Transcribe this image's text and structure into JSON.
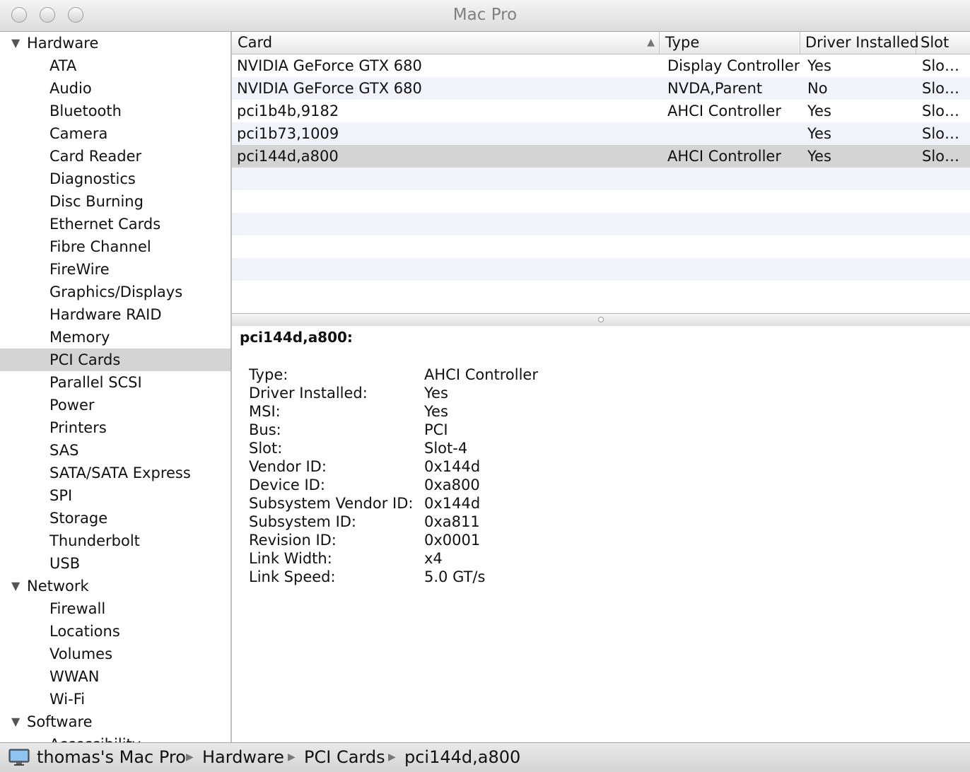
{
  "window": {
    "title": "Mac Pro"
  },
  "sidebar": {
    "hardware": {
      "label": "Hardware",
      "items": [
        "ATA",
        "Audio",
        "Bluetooth",
        "Camera",
        "Card Reader",
        "Diagnostics",
        "Disc Burning",
        "Ethernet Cards",
        "Fibre Channel",
        "FireWire",
        "Graphics/Displays",
        "Hardware RAID",
        "Memory",
        "PCI Cards",
        "Parallel SCSI",
        "Power",
        "Printers",
        "SAS",
        "SATA/SATA Express",
        "SPI",
        "Storage",
        "Thunderbolt",
        "USB"
      ]
    },
    "network": {
      "label": "Network",
      "items": [
        "Firewall",
        "Locations",
        "Volumes",
        "WWAN",
        "Wi-Fi"
      ]
    },
    "software": {
      "label": "Software",
      "items": [
        "Accessibility"
      ]
    },
    "selected": "PCI Cards"
  },
  "table": {
    "columns": {
      "card": "Card",
      "type": "Type",
      "driver": "Driver Installed",
      "slot": "Slot"
    },
    "rows": [
      {
        "card": "NVIDIA GeForce GTX 680",
        "type": "Display Controller",
        "driver": "Yes",
        "slot": "Slo…"
      },
      {
        "card": "NVIDIA GeForce GTX 680",
        "type": "NVDA,Parent",
        "driver": "No",
        "slot": "Slo…"
      },
      {
        "card": "pci1b4b,9182",
        "type": "AHCI Controller",
        "driver": "Yes",
        "slot": "Slo…"
      },
      {
        "card": "pci1b73,1009",
        "type": "",
        "driver": "Yes",
        "slot": "Slo…"
      },
      {
        "card": "pci144d,a800",
        "type": "AHCI Controller",
        "driver": "Yes",
        "slot": "Slo…"
      }
    ],
    "selected_row": 4
  },
  "detail": {
    "title": "pci144d,a800:",
    "fields": [
      {
        "key": "Type:",
        "value": "AHCI Controller"
      },
      {
        "key": "Driver Installed:",
        "value": "Yes"
      },
      {
        "key": "MSI:",
        "value": "Yes"
      },
      {
        "key": "Bus:",
        "value": "PCI"
      },
      {
        "key": "Slot:",
        "value": "Slot-4"
      },
      {
        "key": "Vendor ID:",
        "value": "0x144d"
      },
      {
        "key": "Device ID:",
        "value": "0xa800"
      },
      {
        "key": "Subsystem Vendor ID:",
        "value": "0x144d"
      },
      {
        "key": "Subsystem ID:",
        "value": "0xa811"
      },
      {
        "key": "Revision ID:",
        "value": "0x0001"
      },
      {
        "key": "Link Width:",
        "value": "x4"
      },
      {
        "key": "Link Speed:",
        "value": "5.0 GT/s"
      }
    ]
  },
  "pathbar": {
    "crumbs": [
      "thomas's Mac Pro",
      "Hardware",
      "PCI Cards",
      "pci144d,a800"
    ]
  }
}
